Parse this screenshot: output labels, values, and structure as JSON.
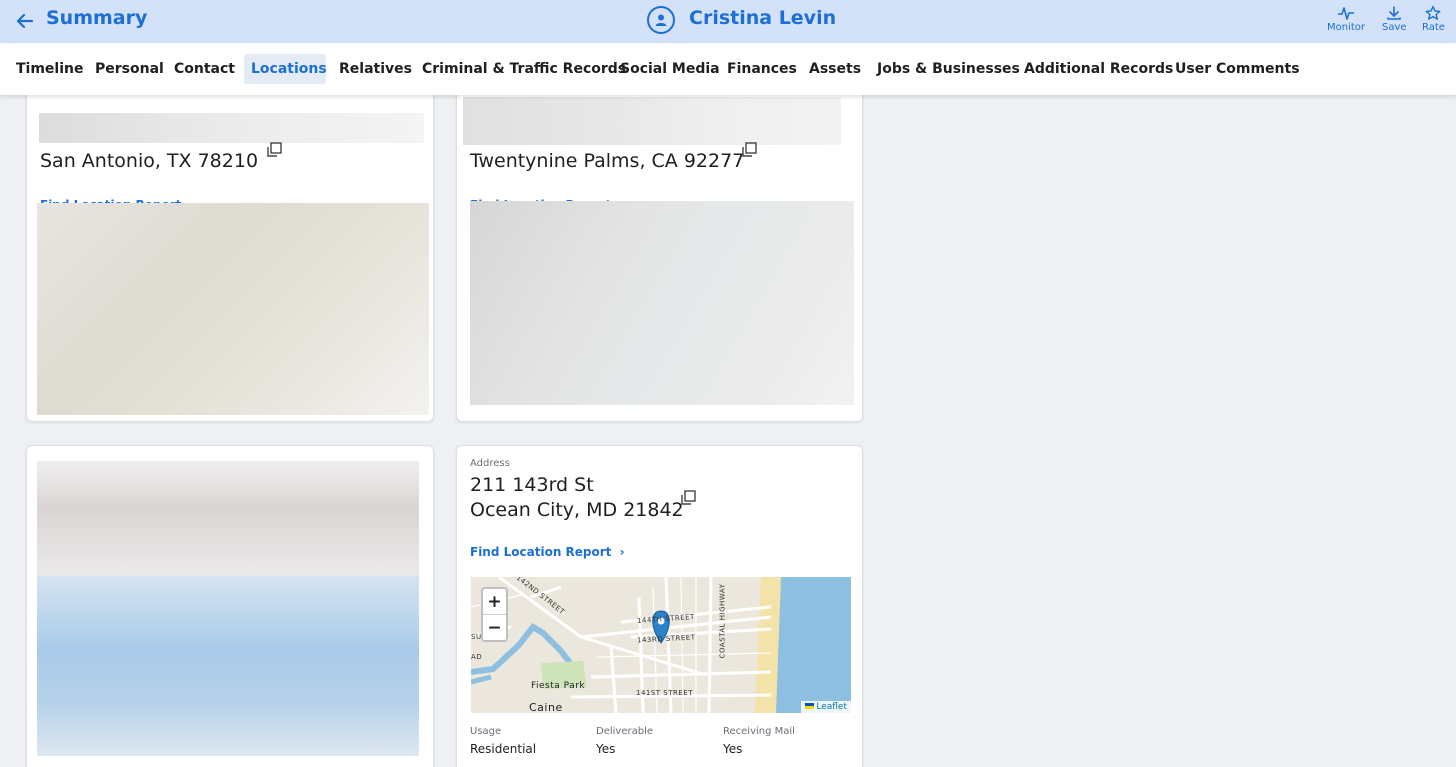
{
  "header": {
    "back_icon": "arrow-left-icon",
    "title": "Summary",
    "person_icon": "person-circle-icon",
    "person_name": "Cristina Levin",
    "actions": [
      {
        "label": "Monitor",
        "icon": "pulse-icon"
      },
      {
        "label": "Save",
        "icon": "download-icon"
      },
      {
        "label": "Rate",
        "icon": "star-icon"
      }
    ]
  },
  "tabs": [
    {
      "label": "Timeline"
    },
    {
      "label": "Personal"
    },
    {
      "label": "Contact"
    },
    {
      "label": "Locations",
      "active": true
    },
    {
      "label": "Relatives"
    },
    {
      "label": "Criminal & Traffic Records"
    },
    {
      "label": "Social Media"
    },
    {
      "label": "Finances"
    },
    {
      "label": "Assets"
    },
    {
      "label": "Jobs & Businesses"
    },
    {
      "label": "Additional Records"
    },
    {
      "label": "User Comments"
    }
  ],
  "cards": [
    {
      "city_line": "San Antonio, TX 78210",
      "link": "Find Location Report"
    },
    {
      "city_line": "Twentynine Palms, CA 92277",
      "link": "Find Location Report"
    },
    {},
    {
      "address_label": "Address",
      "street_line": "211 143rd St",
      "city_line": "Ocean City, MD 21842",
      "link": "Find Location Report",
      "map": {
        "zoom_in": "+",
        "zoom_out": "−",
        "attribution": "Leaflet",
        "streets": [
          "142ND STREET",
          "144TH STREET",
          "143RD STREET",
          "COASTAL HIGHWAY",
          "141ST STREET",
          "Fiesta Park",
          "Caine",
          "SURF",
          "AD"
        ]
      },
      "details": [
        {
          "label": "Usage",
          "value": "Residential"
        },
        {
          "label": "Deliverable",
          "value": "Yes"
        },
        {
          "label": "Receiving Mail",
          "value": "Yes"
        }
      ]
    }
  ],
  "colors": {
    "accent": "#1b6fd6",
    "header_bg": "#d3e2f8",
    "page_bg": "#eef0f3"
  }
}
